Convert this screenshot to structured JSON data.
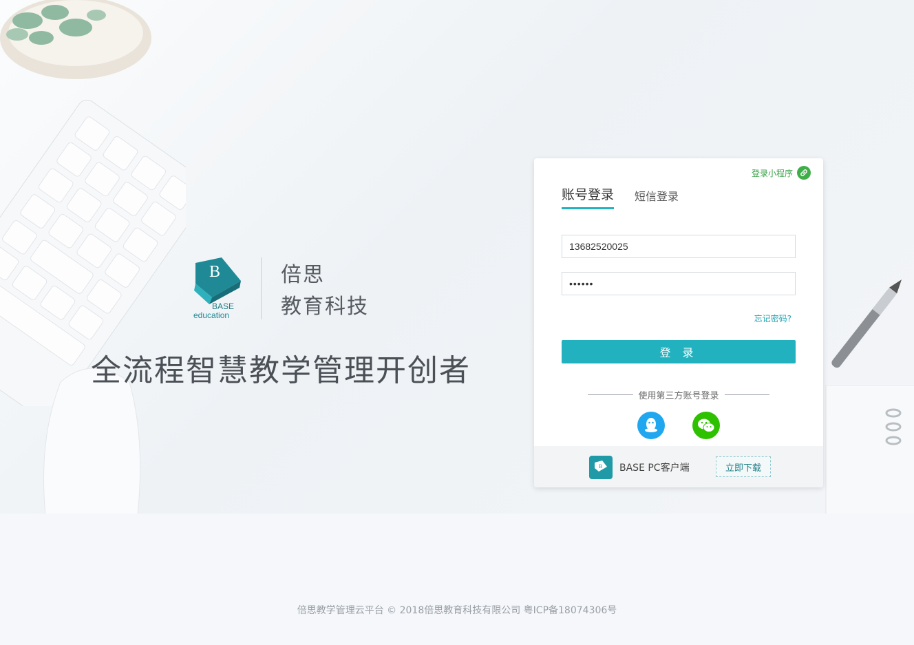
{
  "brand": {
    "logo_text_1": "BASE",
    "logo_text_2": "education",
    "name_line1": "倍思",
    "name_line2": "教育科技",
    "slogan": "全流程智慧教学管理开创者"
  },
  "login_card": {
    "mini_program_link": "登录小程序",
    "mini_program_icon": "link-icon",
    "tabs": [
      {
        "label": "账号登录",
        "active": true
      },
      {
        "label": "短信登录",
        "active": false
      }
    ],
    "username_value": "13682520025",
    "password_value": "••••••",
    "forgot_password": "忘记密码?",
    "login_button": "登 录",
    "third_party_label": "使用第三方账号登录",
    "social": [
      {
        "name": "qq-icon",
        "color": "#21a7ef"
      },
      {
        "name": "wechat-icon",
        "color": "#2ec100"
      }
    ],
    "footer": {
      "client_label": "BASE PC客户端",
      "download_button": "立即下载"
    }
  },
  "colors": {
    "accent": "#22b2bf",
    "mini_program_green": "#3fae49"
  },
  "copyright": "倍思教学管理云平台 © 2018倍思教育科技有限公司 粤ICP备18074306号"
}
